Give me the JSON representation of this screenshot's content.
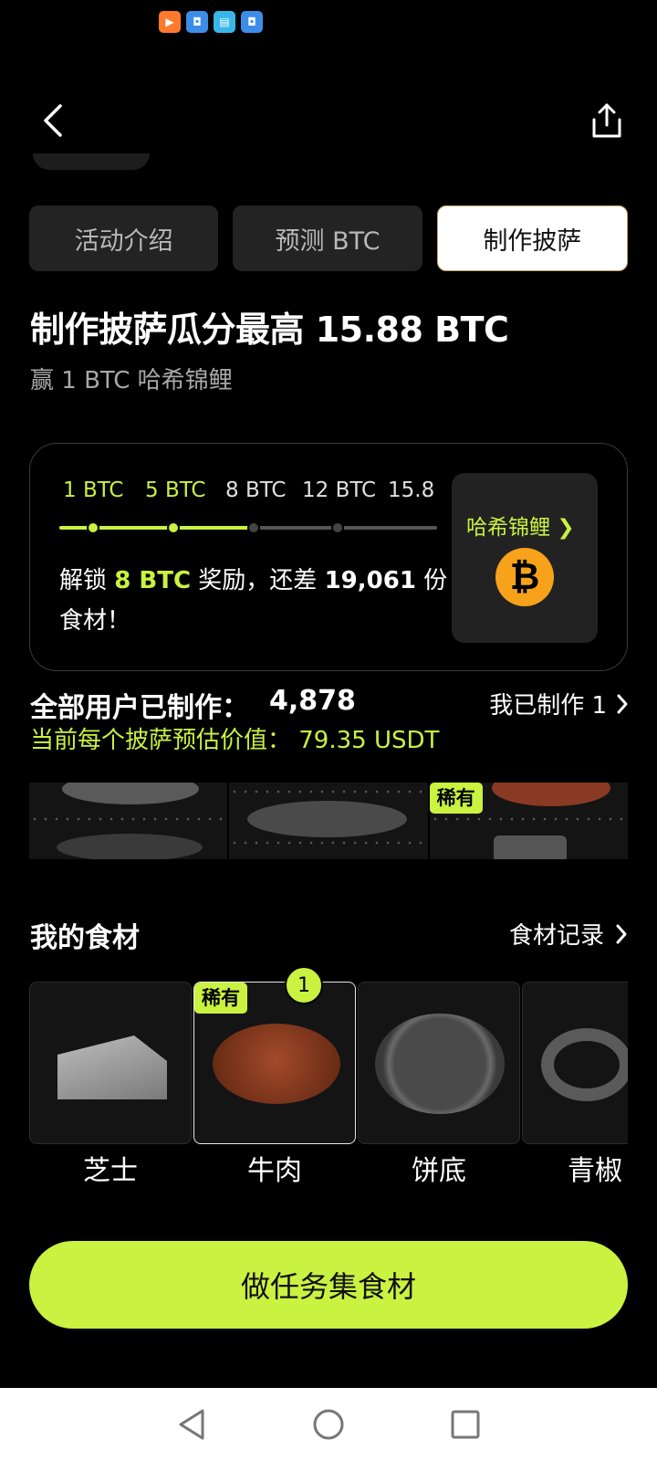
{
  "status_bar": {
    "icons": [
      "video-app-icon",
      "wallet-app-icon",
      "book-app-icon",
      "shield-app-icon"
    ]
  },
  "header": {
    "back_icon": "chevron-left-icon",
    "share_icon": "share-icon"
  },
  "tabs": [
    {
      "label": "活动介绍",
      "active": false
    },
    {
      "label": "预测 BTC",
      "active": false
    },
    {
      "label": "制作披萨",
      "active": true
    }
  ],
  "headline": "制作披萨瓜分最高 15.88 BTC",
  "subline": "赢 1 BTC 哈希锦鲤",
  "progress": {
    "milestones": [
      {
        "label": "1 BTC",
        "reached": true
      },
      {
        "label": "5 BTC",
        "reached": true
      },
      {
        "label": "8 BTC",
        "reached": false
      },
      {
        "label": "12 BTC",
        "reached": false
      },
      {
        "label": "15.8",
        "reached": false
      }
    ],
    "unlock_prefix": "解锁 ",
    "unlock_target": "8 BTC",
    "unlock_middle": " 奖励，还差 ",
    "unlock_count": "19,061",
    "unlock_suffix": " 份食材！",
    "prize_label": "哈希锦鲤",
    "prize_chevron": "❯",
    "prize_coin": "₿"
  },
  "stats": {
    "made_label": "全部用户已制作：",
    "made_value": "4,878",
    "my_made_label": "我已制作 1",
    "estimate_text": "当前每个披萨预估价值： 79.35 USDT"
  },
  "pizza_strip": {
    "rare_badge": "稀有"
  },
  "ingredients_section": {
    "title": "我的食材",
    "records_label": "食材记录"
  },
  "ingredients": [
    {
      "name": "芝士",
      "rare": false,
      "count": null,
      "icon": "cheese-icon"
    },
    {
      "name": "牛肉",
      "rare": true,
      "count": "1",
      "icon": "steak-icon"
    },
    {
      "name": "饼底",
      "rare": false,
      "count": null,
      "icon": "pizza-crust-icon"
    },
    {
      "name": "青椒",
      "rare": false,
      "count": null,
      "icon": "pepper-rings-icon"
    }
  ],
  "rare_label": "稀有",
  "cta_label": "做任务集食材",
  "colors": {
    "accent": "#c9f241",
    "background": "#000000",
    "card": "#232323",
    "coin": "#f7a21a"
  }
}
